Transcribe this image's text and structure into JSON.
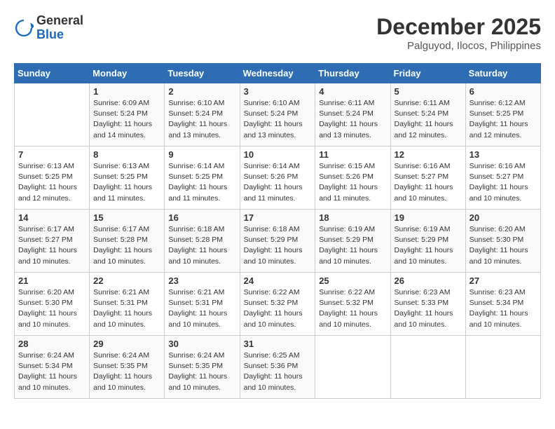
{
  "header": {
    "logo_general": "General",
    "logo_blue": "Blue",
    "title": "December 2025",
    "location": "Palguyod, Ilocos, Philippines"
  },
  "days_of_week": [
    "Sunday",
    "Monday",
    "Tuesday",
    "Wednesday",
    "Thursday",
    "Friday",
    "Saturday"
  ],
  "weeks": [
    [
      {
        "day": "",
        "info": ""
      },
      {
        "day": "1",
        "info": "Sunrise: 6:09 AM\nSunset: 5:24 PM\nDaylight: 11 hours\nand 14 minutes."
      },
      {
        "day": "2",
        "info": "Sunrise: 6:10 AM\nSunset: 5:24 PM\nDaylight: 11 hours\nand 13 minutes."
      },
      {
        "day": "3",
        "info": "Sunrise: 6:10 AM\nSunset: 5:24 PM\nDaylight: 11 hours\nand 13 minutes."
      },
      {
        "day": "4",
        "info": "Sunrise: 6:11 AM\nSunset: 5:24 PM\nDaylight: 11 hours\nand 13 minutes."
      },
      {
        "day": "5",
        "info": "Sunrise: 6:11 AM\nSunset: 5:24 PM\nDaylight: 11 hours\nand 12 minutes."
      },
      {
        "day": "6",
        "info": "Sunrise: 6:12 AM\nSunset: 5:25 PM\nDaylight: 11 hours\nand 12 minutes."
      }
    ],
    [
      {
        "day": "7",
        "info": "Sunrise: 6:13 AM\nSunset: 5:25 PM\nDaylight: 11 hours\nand 12 minutes."
      },
      {
        "day": "8",
        "info": "Sunrise: 6:13 AM\nSunset: 5:25 PM\nDaylight: 11 hours\nand 11 minutes."
      },
      {
        "day": "9",
        "info": "Sunrise: 6:14 AM\nSunset: 5:25 PM\nDaylight: 11 hours\nand 11 minutes."
      },
      {
        "day": "10",
        "info": "Sunrise: 6:14 AM\nSunset: 5:26 PM\nDaylight: 11 hours\nand 11 minutes."
      },
      {
        "day": "11",
        "info": "Sunrise: 6:15 AM\nSunset: 5:26 PM\nDaylight: 11 hours\nand 11 minutes."
      },
      {
        "day": "12",
        "info": "Sunrise: 6:16 AM\nSunset: 5:27 PM\nDaylight: 11 hours\nand 10 minutes."
      },
      {
        "day": "13",
        "info": "Sunrise: 6:16 AM\nSunset: 5:27 PM\nDaylight: 11 hours\nand 10 minutes."
      }
    ],
    [
      {
        "day": "14",
        "info": "Sunrise: 6:17 AM\nSunset: 5:27 PM\nDaylight: 11 hours\nand 10 minutes."
      },
      {
        "day": "15",
        "info": "Sunrise: 6:17 AM\nSunset: 5:28 PM\nDaylight: 11 hours\nand 10 minutes."
      },
      {
        "day": "16",
        "info": "Sunrise: 6:18 AM\nSunset: 5:28 PM\nDaylight: 11 hours\nand 10 minutes."
      },
      {
        "day": "17",
        "info": "Sunrise: 6:18 AM\nSunset: 5:29 PM\nDaylight: 11 hours\nand 10 minutes."
      },
      {
        "day": "18",
        "info": "Sunrise: 6:19 AM\nSunset: 5:29 PM\nDaylight: 11 hours\nand 10 minutes."
      },
      {
        "day": "19",
        "info": "Sunrise: 6:19 AM\nSunset: 5:29 PM\nDaylight: 11 hours\nand 10 minutes."
      },
      {
        "day": "20",
        "info": "Sunrise: 6:20 AM\nSunset: 5:30 PM\nDaylight: 11 hours\nand 10 minutes."
      }
    ],
    [
      {
        "day": "21",
        "info": "Sunrise: 6:20 AM\nSunset: 5:30 PM\nDaylight: 11 hours\nand 10 minutes."
      },
      {
        "day": "22",
        "info": "Sunrise: 6:21 AM\nSunset: 5:31 PM\nDaylight: 11 hours\nand 10 minutes."
      },
      {
        "day": "23",
        "info": "Sunrise: 6:21 AM\nSunset: 5:31 PM\nDaylight: 11 hours\nand 10 minutes."
      },
      {
        "day": "24",
        "info": "Sunrise: 6:22 AM\nSunset: 5:32 PM\nDaylight: 11 hours\nand 10 minutes."
      },
      {
        "day": "25",
        "info": "Sunrise: 6:22 AM\nSunset: 5:32 PM\nDaylight: 11 hours\nand 10 minutes."
      },
      {
        "day": "26",
        "info": "Sunrise: 6:23 AM\nSunset: 5:33 PM\nDaylight: 11 hours\nand 10 minutes."
      },
      {
        "day": "27",
        "info": "Sunrise: 6:23 AM\nSunset: 5:34 PM\nDaylight: 11 hours\nand 10 minutes."
      }
    ],
    [
      {
        "day": "28",
        "info": "Sunrise: 6:24 AM\nSunset: 5:34 PM\nDaylight: 11 hours\nand 10 minutes."
      },
      {
        "day": "29",
        "info": "Sunrise: 6:24 AM\nSunset: 5:35 PM\nDaylight: 11 hours\nand 10 minutes."
      },
      {
        "day": "30",
        "info": "Sunrise: 6:24 AM\nSunset: 5:35 PM\nDaylight: 11 hours\nand 10 minutes."
      },
      {
        "day": "31",
        "info": "Sunrise: 6:25 AM\nSunset: 5:36 PM\nDaylight: 11 hours\nand 10 minutes."
      },
      {
        "day": "",
        "info": ""
      },
      {
        "day": "",
        "info": ""
      },
      {
        "day": "",
        "info": ""
      }
    ]
  ]
}
